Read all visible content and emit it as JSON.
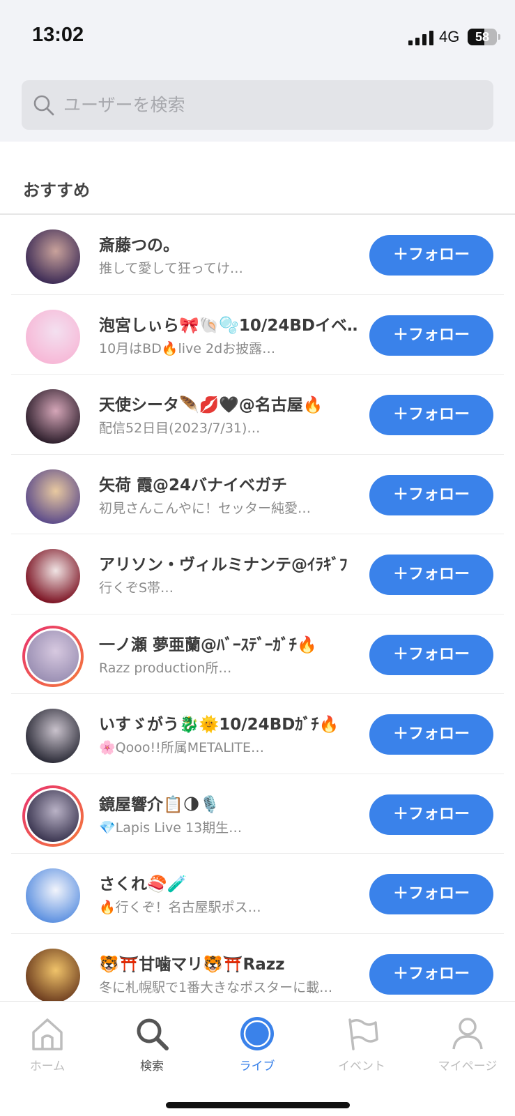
{
  "status_bar": {
    "time": "13:02",
    "network": "4G",
    "battery": "58",
    "battery_level": 0.58
  },
  "search": {
    "placeholder": "ユーザーを検索"
  },
  "section": {
    "title": "おすすめ"
  },
  "follow_label": "＋フォロー",
  "users": [
    {
      "name": "斎藤つの。",
      "bio": "推して愛して狂ってけ…",
      "ring": false,
      "avatar_colors": [
        "#3b2a55",
        "#c9a29b"
      ]
    },
    {
      "name": "泡宮しぃら🎀🐚🫧10/24BDイベ…",
      "bio": "10月はBD🔥live 2dお披露…",
      "ring": false,
      "avatar_colors": [
        "#f7b7d6",
        "#f3e0f0"
      ]
    },
    {
      "name": "天使シータ🪶💋🖤@名古屋🔥",
      "bio": "配信52日目(2023/7/31)…",
      "ring": false,
      "avatar_colors": [
        "#2b1d2a",
        "#d5a6b8"
      ]
    },
    {
      "name": "矢荷 霞@24バナイベガチ",
      "bio": "初見さんこんやに！セッター純愛…",
      "ring": false,
      "avatar_colors": [
        "#5b4a8a",
        "#e8c9a0"
      ]
    },
    {
      "name": "アリソン・ヴィルミナンテ@ｲﾗｷﾞﾌ",
      "bio": "行くぞS帯…",
      "ring": false,
      "avatar_colors": [
        "#7a1020",
        "#f0e4e4"
      ]
    },
    {
      "name": "一ノ瀬 夢亜蘭@ﾊﾞｰｽﾃﾞｰｶﾞﾁ🔥",
      "bio": "Razz production所…",
      "ring": true,
      "avatar_colors": [
        "#9a8fb3",
        "#d7c9e0"
      ]
    },
    {
      "name": "いすゞがう🐉🌞10/24BDｶﾞﾁ🔥",
      "bio": "🌸Qooo!!所属METALITE…",
      "ring": false,
      "avatar_colors": [
        "#2a2a36",
        "#c9c2cc"
      ]
    },
    {
      "name": "鏡屋響介📋🌗🎙️",
      "bio": "💎Lapis Live 13期生…",
      "ring": true,
      "avatar_colors": [
        "#3a3550",
        "#b9b2c6"
      ]
    },
    {
      "name": "さくれ🍣🧪",
      "bio": "🔥行くぞ！名古屋駅ポス…",
      "ring": false,
      "avatar_colors": [
        "#5a8fe0",
        "#f2f4fb"
      ]
    },
    {
      "name": "🐯⛩️甘噛マリ🐯⛩️Razz",
      "bio": "冬に札幌駅で1番大きなポスターに載…",
      "ring": false,
      "avatar_colors": [
        "#6b3b1e",
        "#f0c36a"
      ]
    }
  ],
  "nav": {
    "home": "ホーム",
    "search": "検索",
    "live": "ライブ",
    "event": "イベント",
    "mypage": "マイページ"
  },
  "colors": {
    "accent": "#3a82ea",
    "ring": "#e8316f"
  }
}
